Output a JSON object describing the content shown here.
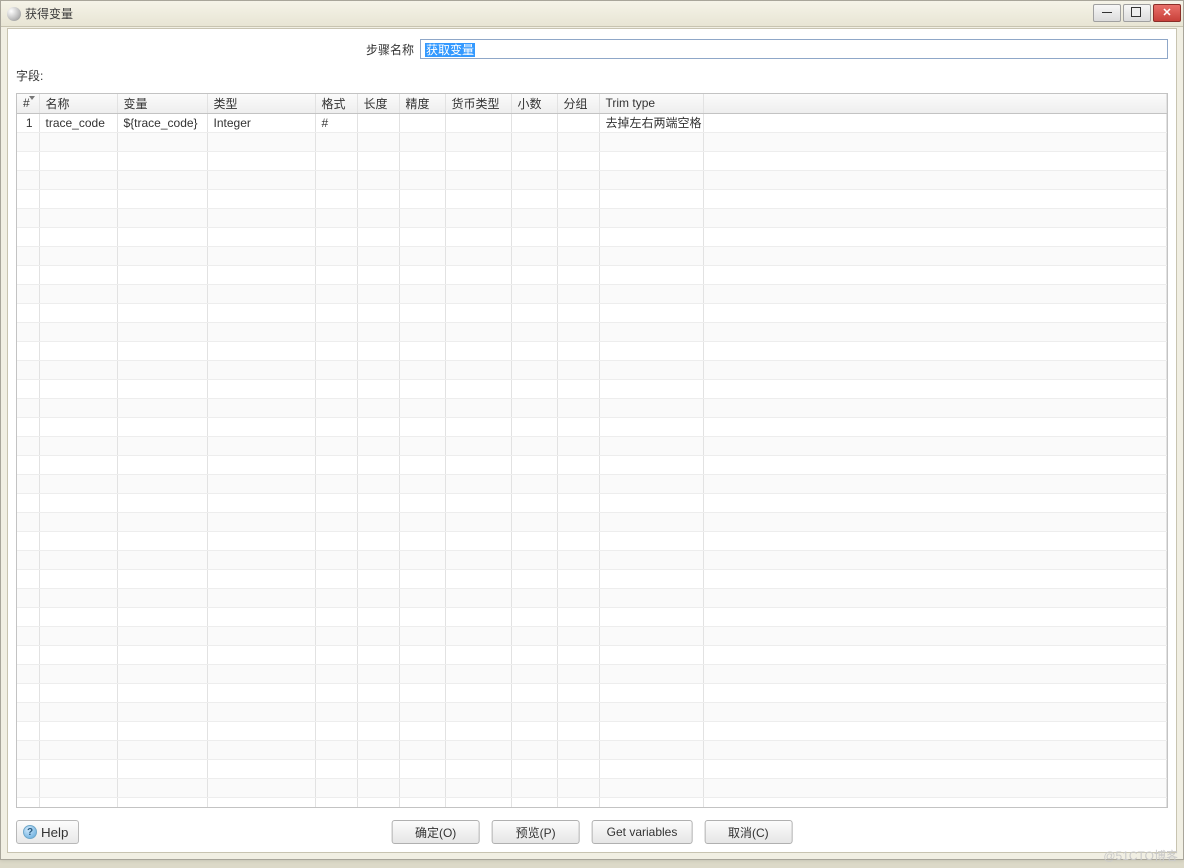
{
  "window": {
    "title": "获得变量"
  },
  "form": {
    "step_name_label": "步骤名称",
    "step_name_value": "获取变量",
    "fields_label": "字段:"
  },
  "grid": {
    "headers": {
      "index": "#",
      "name": "名称",
      "variable": "变量",
      "type": "类型",
      "format": "格式",
      "length": "长度",
      "precision": "精度",
      "currency": "货币类型",
      "decimals": "小数",
      "group": "分组",
      "trim": "Trim type"
    },
    "rows": [
      {
        "index": "1",
        "name": "trace_code",
        "variable": "${trace_code}",
        "type": "Integer",
        "format": "#",
        "length": "",
        "precision": "",
        "currency": "",
        "decimals": "",
        "group": "",
        "trim": "去掉左右两端空格"
      }
    ]
  },
  "buttons": {
    "help": "Help",
    "ok": "确定(O)",
    "preview": "预览(P)",
    "get_variables": "Get variables",
    "cancel": "取消(C)"
  },
  "watermark": "@51CTO博客"
}
